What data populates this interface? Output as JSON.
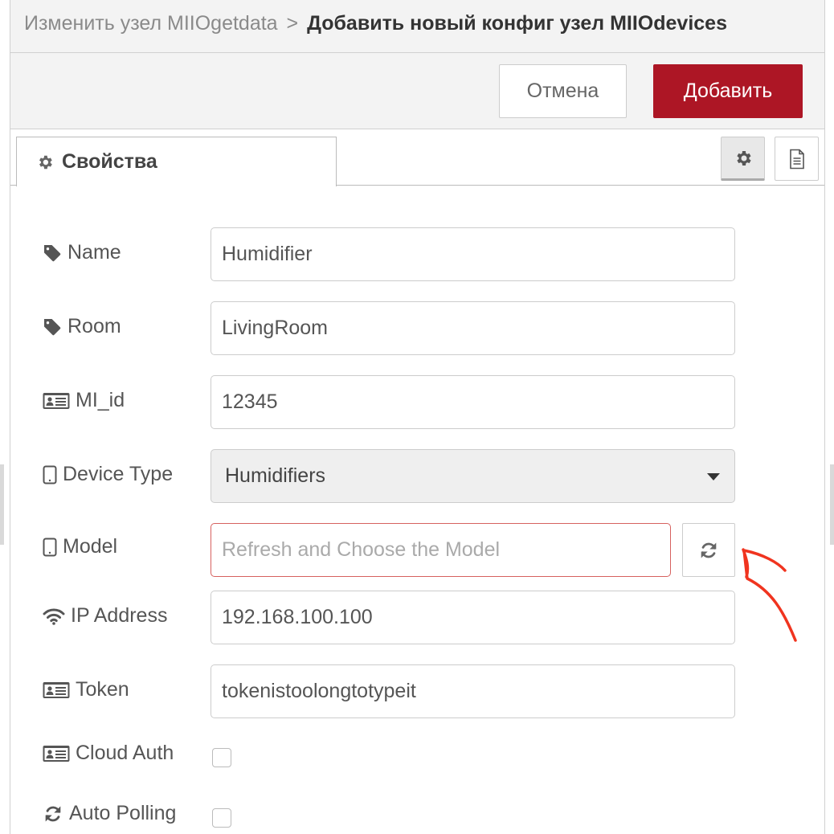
{
  "header": {
    "breadcrumb_prev": "Изменить узел MIIOgetdata",
    "breadcrumb_sep": ">",
    "breadcrumb_current": "Добавить новый конфиг узел MIIOdevices"
  },
  "toolbar": {
    "cancel_label": "Отмена",
    "add_label": "Добавить",
    "add_color": "#ad1625"
  },
  "tabs": {
    "properties_label": "Свойства",
    "tools": [
      "gear-icon",
      "document-icon"
    ]
  },
  "form": {
    "name": {
      "label": "Name",
      "icon": "tag-icon",
      "value": "Humidifier"
    },
    "room": {
      "label": "Room",
      "icon": "tag-icon",
      "value": "LivingRoom"
    },
    "mi_id": {
      "label": "MI_id",
      "icon": "id-card-icon",
      "value": "12345"
    },
    "device_type": {
      "label": "Device Type",
      "icon": "tablet-icon",
      "value": "Humidifiers"
    },
    "model": {
      "label": "Model",
      "icon": "tablet-icon",
      "value": "",
      "placeholder": "Refresh and Choose the Model",
      "state": "error"
    },
    "ip_address": {
      "label": "IP Address",
      "icon": "wifi-icon",
      "value": "192.168.100.100"
    },
    "token": {
      "label": "Token",
      "icon": "id-card-icon",
      "value": "tokenistoolongtotypeit"
    },
    "cloud_auth": {
      "label": "Cloud Auth",
      "icon": "id-card-icon",
      "checked": false
    },
    "auto_polling": {
      "label": "Auto Polling",
      "icon": "refresh-icon",
      "checked": false
    }
  },
  "annotation": {
    "type": "hand-drawn-arrow",
    "color": "#f0341f",
    "points_to": "model-refresh-button"
  }
}
